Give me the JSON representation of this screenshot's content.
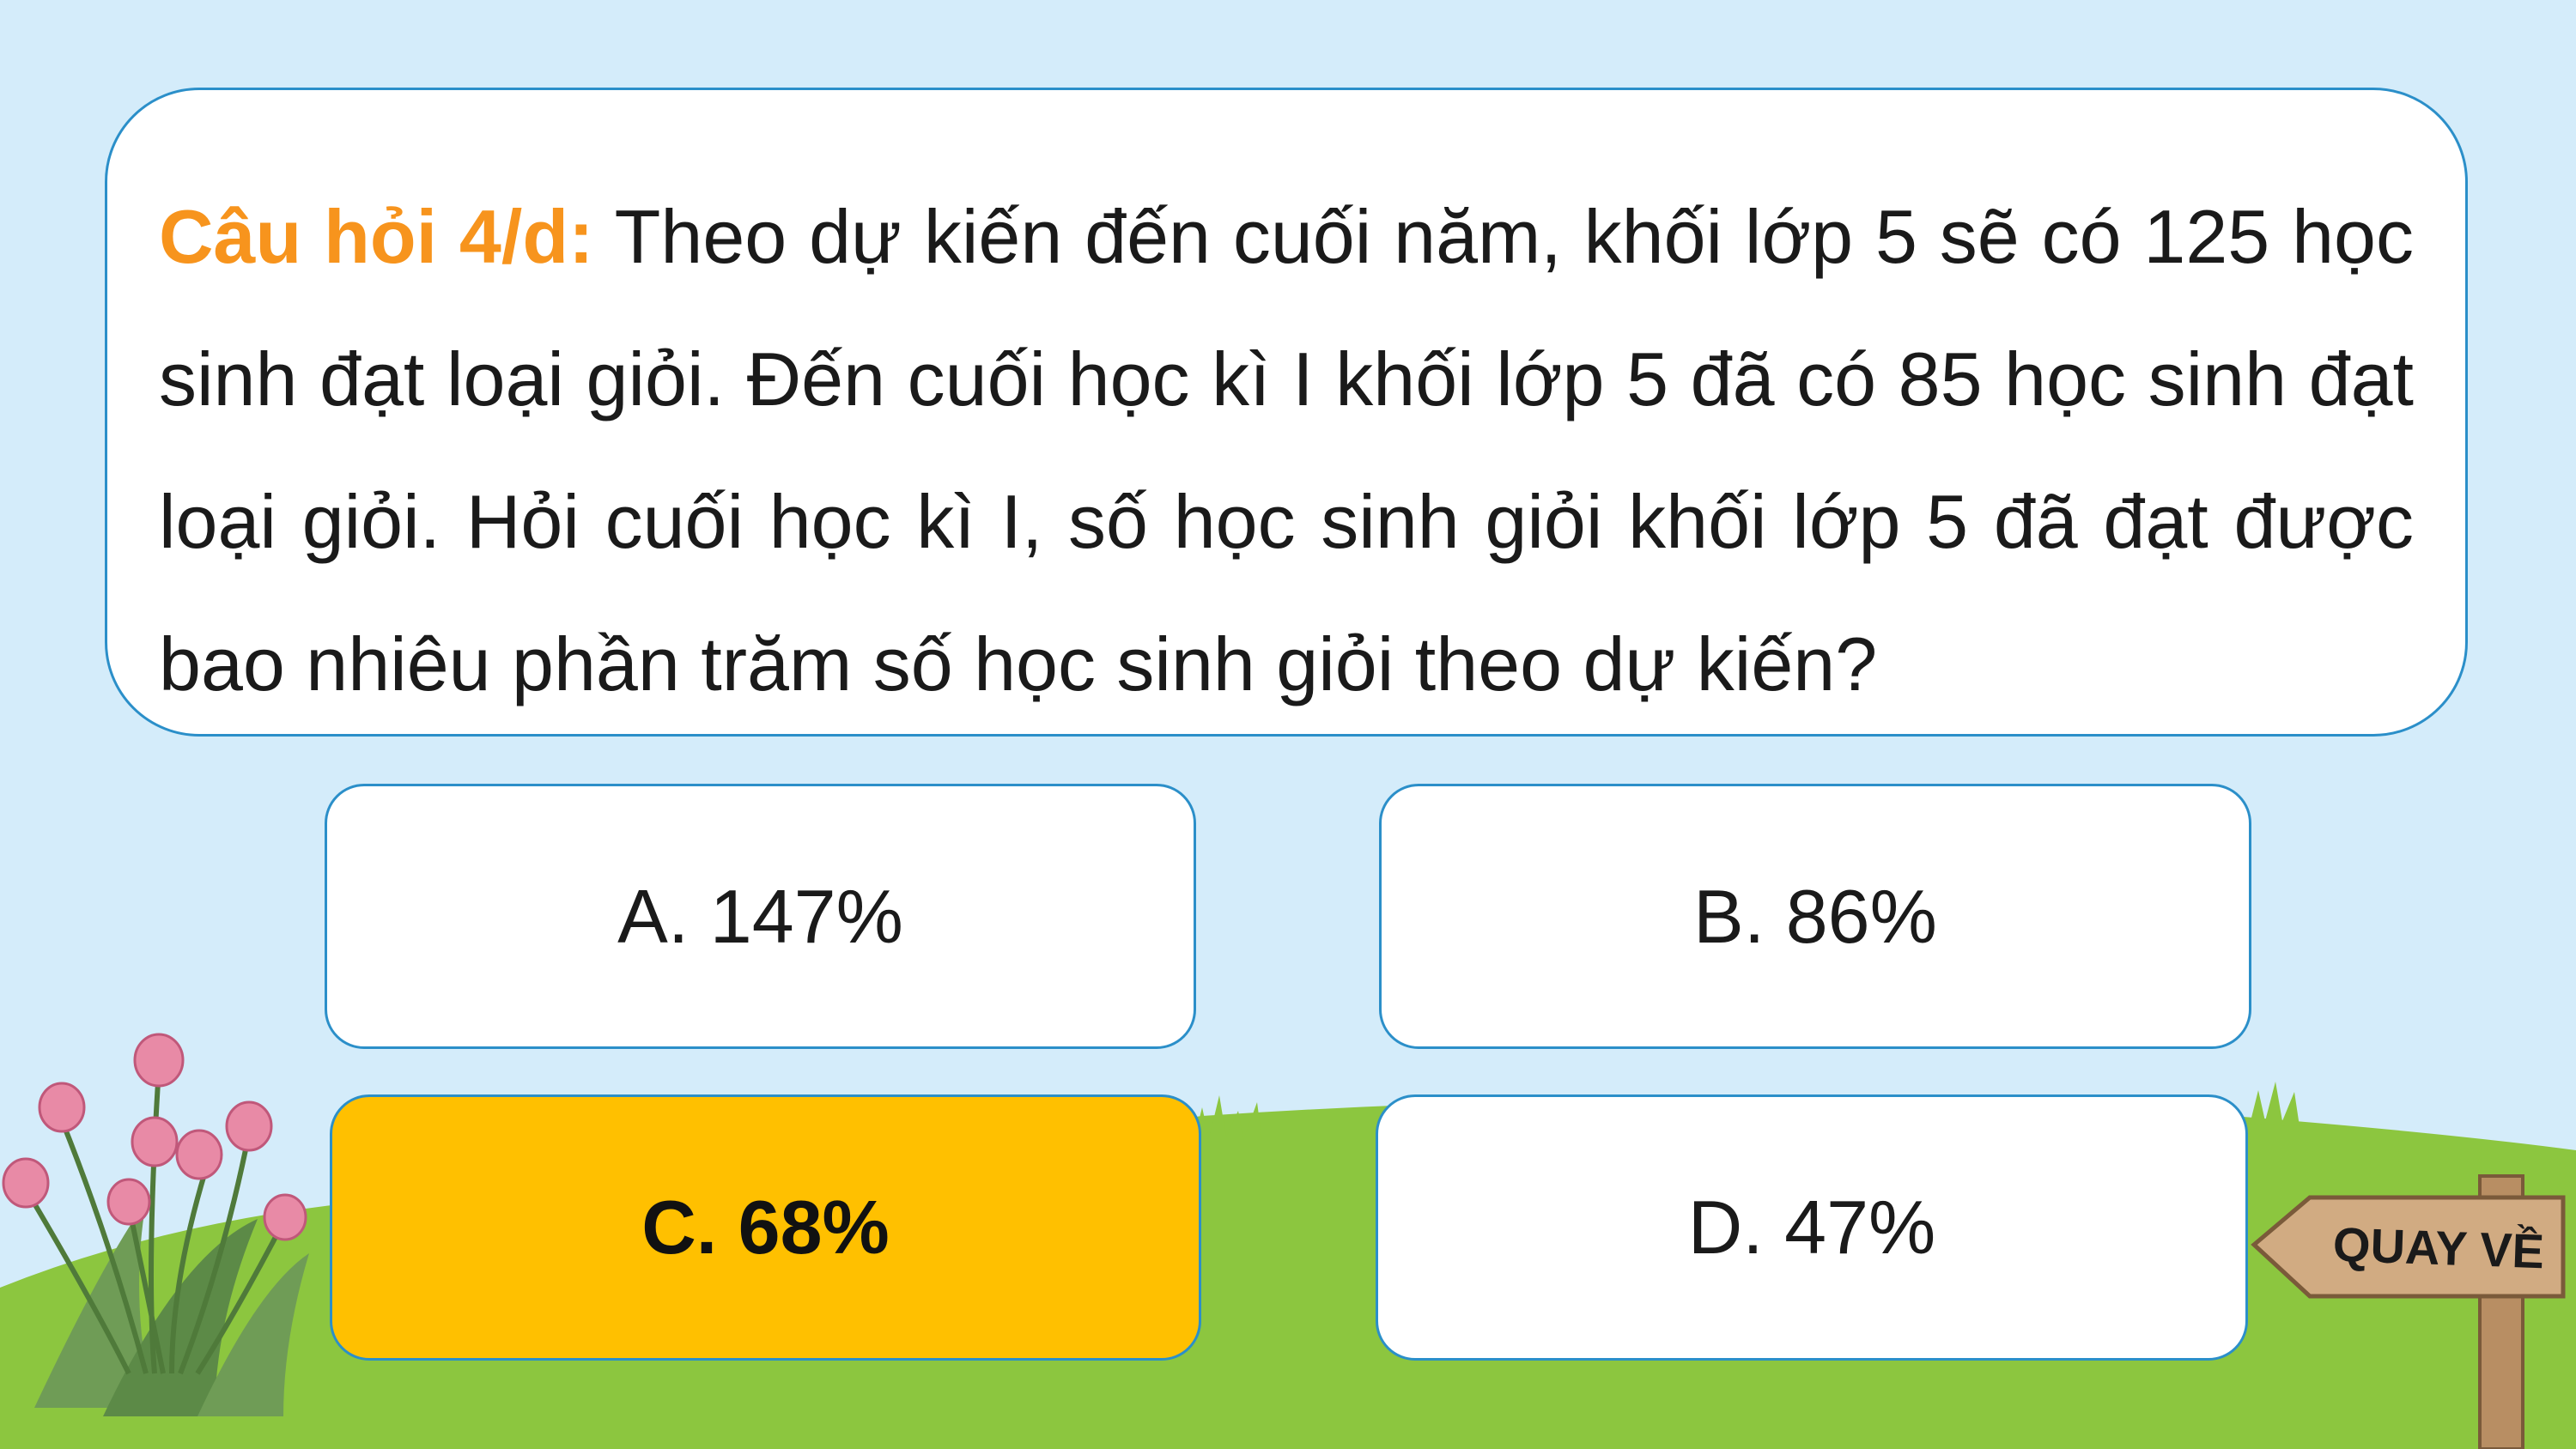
{
  "question": {
    "label": "Câu hỏi 4/d:",
    "text": " Theo dự kiến đến cuối năm, khối lớp 5 sẽ có 125 học sinh đạt loại giỏi. Đến cuối học kì I khối lớp 5 đã có 85 học sinh đạt loại giỏi. Hỏi cuối học kì I, số học sinh giỏi khối lớp 5 đã đạt được bao nhiêu phần trăm số học sinh giỏi theo dự kiến?"
  },
  "options": {
    "a": "A. 147%",
    "b": "B. 86%",
    "c": "C. 68%",
    "d": "D. 47%"
  },
  "selected_option": "C. 68%",
  "back_button": {
    "label": "QUAY VỀ"
  },
  "colors": {
    "sky": "#d4ecfa",
    "grass": "#8cc63f",
    "card_border": "#2b8fc9",
    "question_label": "#f7941d",
    "correct_answer": "#ffc000",
    "sign_wood": "#c9a27a",
    "flower_pink": "#e88aa6"
  }
}
